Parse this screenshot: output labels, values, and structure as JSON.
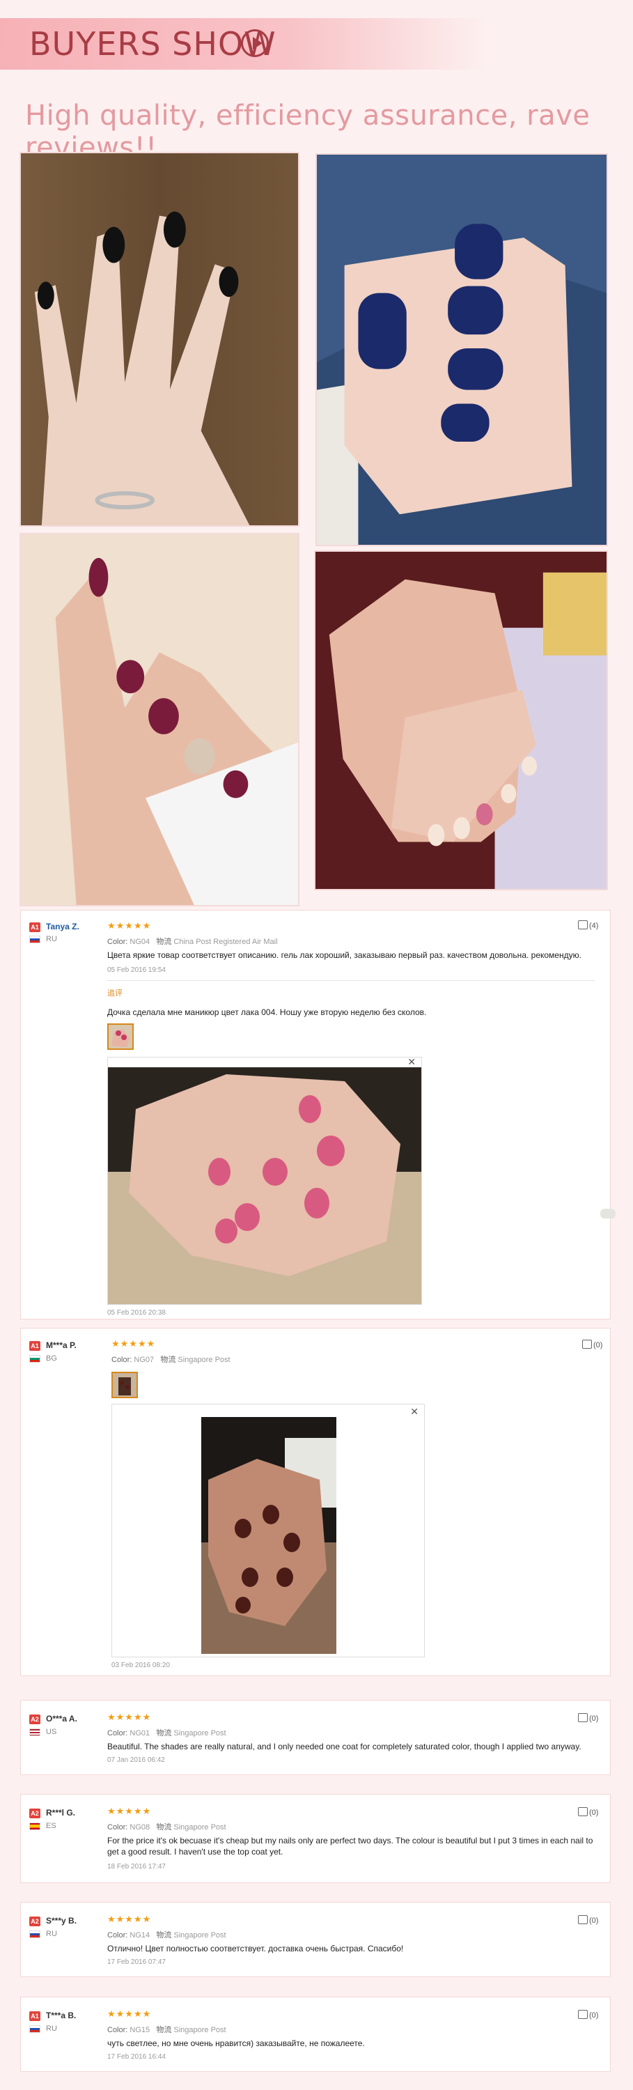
{
  "banner": {
    "title": "BUYERS SHOW"
  },
  "tagline": "High quality, efficiency assurance, rave reviews!!",
  "labels": {
    "color": "Color:",
    "shipping_cn": "物流",
    "followup": "追评"
  },
  "reviews": [
    {
      "badge": "A1",
      "user": "Tanya Z.",
      "country": "RU",
      "stars": "★★★★★",
      "color": "NG04",
      "shipping": "China Post Registered Air Mail",
      "text": "Цвета яркие товар соответствует описанию. гель лак хороший, заказываю первый раз. качеством довольна. рекомендую.",
      "date": "05 Feb 2016 19:54",
      "likes": "(4)",
      "followup_text": "Дочка сделала мне маникюр цвет лака 004. Ношу уже вторую неделю без сколов.",
      "followup_date": "05 Feb 2016 20:38"
    },
    {
      "badge": "A1",
      "user": "M***a P.",
      "country": "BG",
      "stars": "★★★★★",
      "color": "NG07",
      "shipping": "Singapore Post",
      "date": "03 Feb 2016 08:20",
      "likes": "(0)"
    },
    {
      "badge": "A2",
      "user": "O***a A.",
      "country": "US",
      "stars": "★★★★★",
      "color": "NG01",
      "shipping": "Singapore Post",
      "text": "Beautiful. The shades are really natural, and I only needed one coat for completely saturated color, though I applied two anyway.",
      "date": "07 Jan 2016 06:42",
      "likes": "(0)"
    },
    {
      "badge": "A2",
      "user": "R***l G.",
      "country": "ES",
      "stars": "★★★★★",
      "color": "NG08",
      "shipping": "Singapore Post",
      "text": "For the price it's ok becuase it's cheap but my nails only are perfect two days. The colour is beautiful but I put 3 times in each nail to get a good result. I haven't use the top coat yet.",
      "date": "18 Feb 2016 17:47",
      "likes": "(0)"
    },
    {
      "badge": "A2",
      "user": "S***y B.",
      "country": "RU",
      "stars": "★★★★★",
      "color": "NG14",
      "shipping": "Singapore Post",
      "text": "Отлично! Цвет полностью соответствует. доставка очень быстрая. Спасибо!",
      "date": "17 Feb 2016 07:47",
      "likes": "(0)"
    },
    {
      "badge": "A1",
      "user": "T***a B.",
      "country": "RU",
      "stars": "★★★★★",
      "color": "NG15",
      "shipping": "Singapore Post",
      "text": "чуть светлее, но мне очень нравится) заказывайте, не пожалеете.",
      "date": "17 Feb 2016 16:44",
      "likes": "(0)"
    }
  ]
}
